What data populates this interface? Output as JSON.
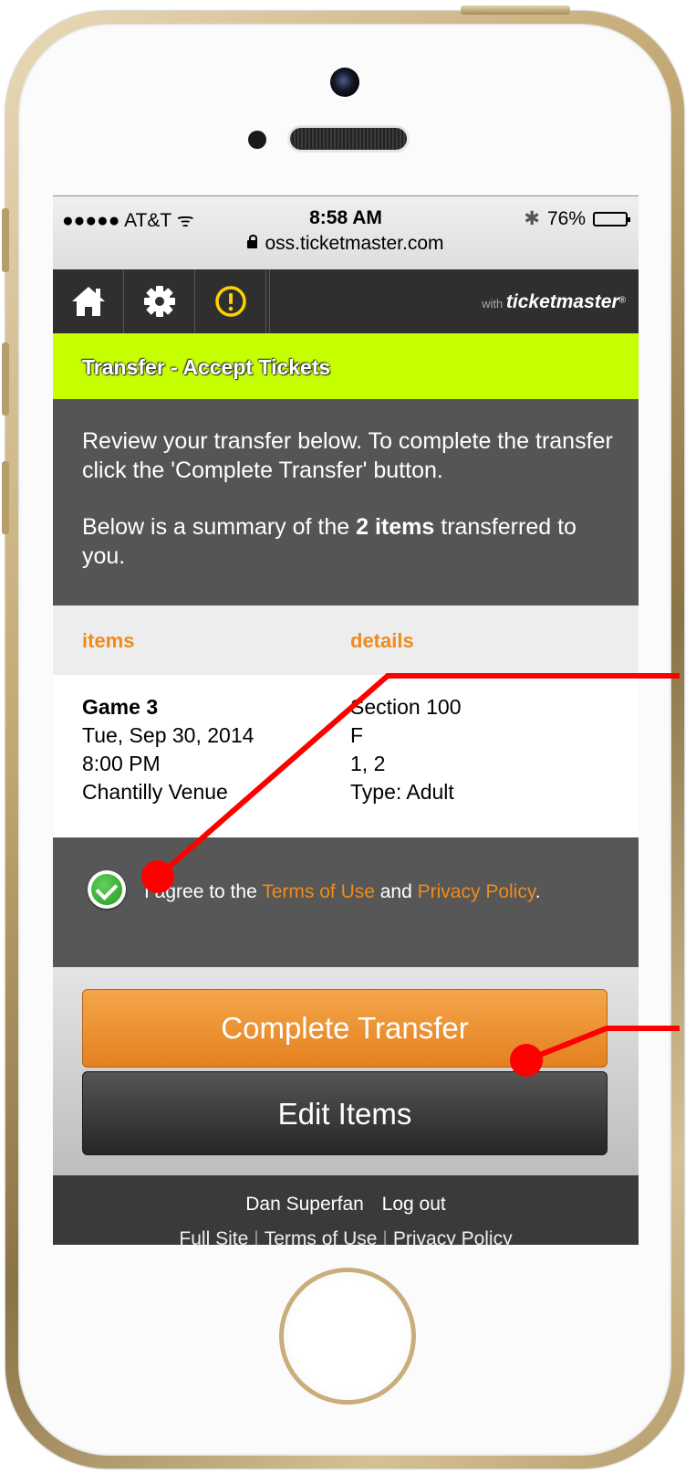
{
  "status_bar": {
    "carrier": "●●●●● AT&T",
    "wifi": "ᯤ",
    "time": "8:58 AM",
    "bluetooth": "✱",
    "battery_text": "76%",
    "battery_level": 0.76
  },
  "browser": {
    "url": "oss.ticketmaster.com"
  },
  "nav": {
    "icons": [
      "home-icon",
      "gear-icon",
      "alert-icon"
    ],
    "brand_prefix": "with",
    "brand_name": "ticketmaster",
    "brand_mark": "®"
  },
  "header": {
    "title": "Transfer - Accept Tickets"
  },
  "intro": {
    "line1": "Review your transfer below. To complete the transfer click the 'Complete Transfer' button.",
    "summary_pre": "Below is a summary of the ",
    "summary_bold": "2 items",
    "summary_post": " transferred to you."
  },
  "table": {
    "columns": [
      "items",
      "details"
    ],
    "row": {
      "items": [
        "Game 3",
        "Tue, Sep 30, 2014",
        "8:00 PM",
        "Chantilly Venue"
      ],
      "details": [
        "Section 100",
        "F",
        "1, 2",
        "Type: Adult"
      ]
    }
  },
  "agreement": {
    "pre": "I agree to the ",
    "terms_link": "Terms of Use",
    "mid": " and ",
    "privacy_link": "Privacy Policy",
    "post": "."
  },
  "buttons": {
    "complete": "Complete Transfer",
    "edit": "Edit Items"
  },
  "footer": {
    "user": "Dan Superfan",
    "logout": "Log out",
    "links": [
      "Full Site",
      "Terms of Use",
      "Privacy Policy"
    ]
  },
  "colors": {
    "accent_green": "#c6ff00",
    "link_orange": "#f08a1c",
    "button_orange": "#e48020",
    "alert_yellow": "#ffd100",
    "annotation_red": "#ff0000"
  }
}
